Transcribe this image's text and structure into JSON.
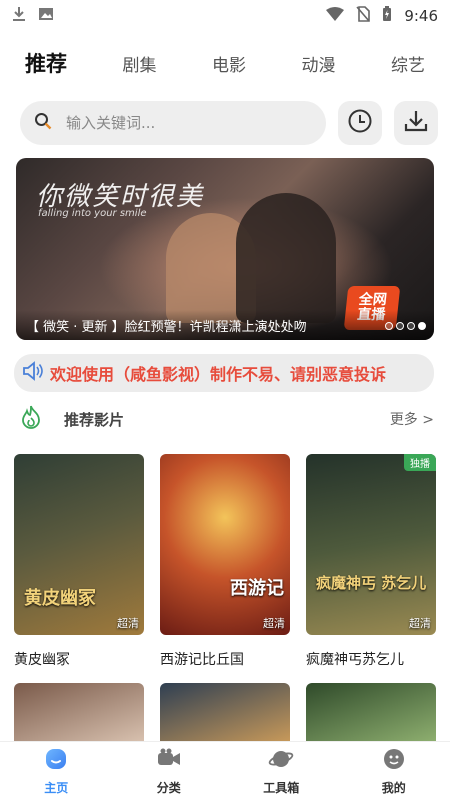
{
  "status_bar": {
    "time": "9:46"
  },
  "top_tabs": [
    {
      "label": "推荐",
      "active": true
    },
    {
      "label": "剧集"
    },
    {
      "label": "电影"
    },
    {
      "label": "动漫"
    },
    {
      "label": "综艺"
    }
  ],
  "search": {
    "placeholder": "输入关键词..."
  },
  "banner": {
    "title": "你微笑时很美",
    "subtitle": "falling into your smile",
    "caption": "【 微笑 · 更新 】脸红预警！许凯程潇上演处处吻",
    "badge_line1": "全网",
    "badge_line2": "直播",
    "slide_count": 4,
    "active_slide": 4
  },
  "notice": {
    "text": "欢迎使用（咸鱼影视）制作不易、请别恶意投诉"
  },
  "section": {
    "title": "推荐影片",
    "more": "更多 >"
  },
  "movies": [
    {
      "title": "黄皮幽冢",
      "poster_text": "黄皮幽冢",
      "quality": "超清",
      "tag": "",
      "color1": "#3b4a3a",
      "color2": "#a07a3c"
    },
    {
      "title": "西游记比丘国",
      "poster_text": "西游记",
      "quality": "超清",
      "tag": "",
      "color1": "#7a2418",
      "color2": "#e0a23a"
    },
    {
      "title": "疯魔神丐苏乞儿",
      "poster_text": "疯魔神丐 苏乞儿",
      "quality": "超清",
      "tag": "独播",
      "color1": "#2c3a2a",
      "color2": "#9a8a52"
    }
  ],
  "movies_row2": [
    {
      "color1": "#8a6a5a",
      "color2": "#d9c2b0"
    },
    {
      "color1": "#3a4a5a",
      "color2": "#c99a5a"
    },
    {
      "color1": "#3a5a32",
      "color2": "#8fb070"
    }
  ],
  "bottom_nav": [
    {
      "label": "主页",
      "active": true,
      "icon": "home-icon"
    },
    {
      "label": "分类",
      "icon": "video-camera-icon"
    },
    {
      "label": "工具箱",
      "icon": "planet-icon"
    },
    {
      "label": "我的",
      "icon": "face-icon"
    }
  ],
  "colors": {
    "accent": "#3a8ef6",
    "notice_red": "#e74c3c",
    "badge_orange": "#e94a1f",
    "fire_green": "#3aa757"
  }
}
